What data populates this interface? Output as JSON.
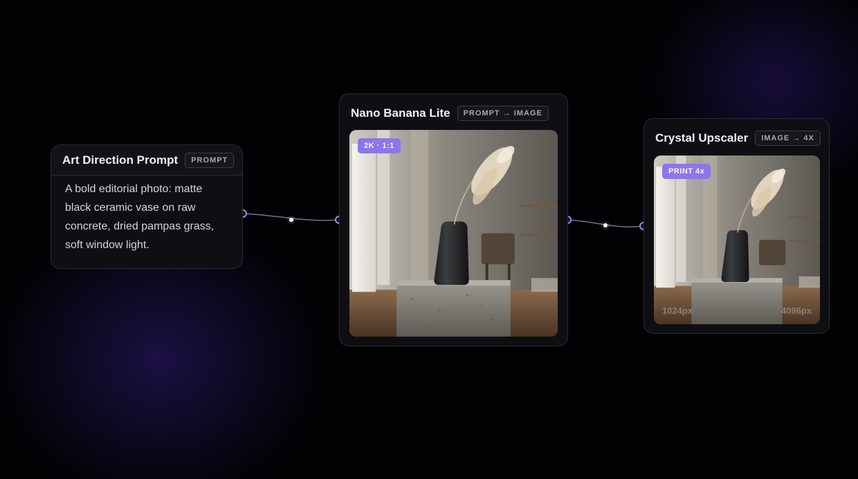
{
  "nodes": {
    "prompt": {
      "title": "Art Direction Prompt",
      "badge": "PROMPT",
      "text": "A bold editorial photo: matte black ceramic vase on raw concrete, dried pampas grass, soft window light."
    },
    "generator": {
      "title": "Nano Banana Lite",
      "badge": "PROMPT → IMAGE",
      "chip": "2K · 1:1"
    },
    "upscaler": {
      "title": "Crystal Upscaler",
      "badge": "IMAGE → 4X",
      "chip": "PRINT 4x",
      "size_before": "1024px",
      "size_after": "4096px"
    }
  },
  "colors": {
    "accent": "#8b78e6",
    "wire": "#8f8fa8",
    "port": "#9a8cf0",
    "node_bg": "#0f0f13",
    "node_border": "#2a2a31"
  }
}
